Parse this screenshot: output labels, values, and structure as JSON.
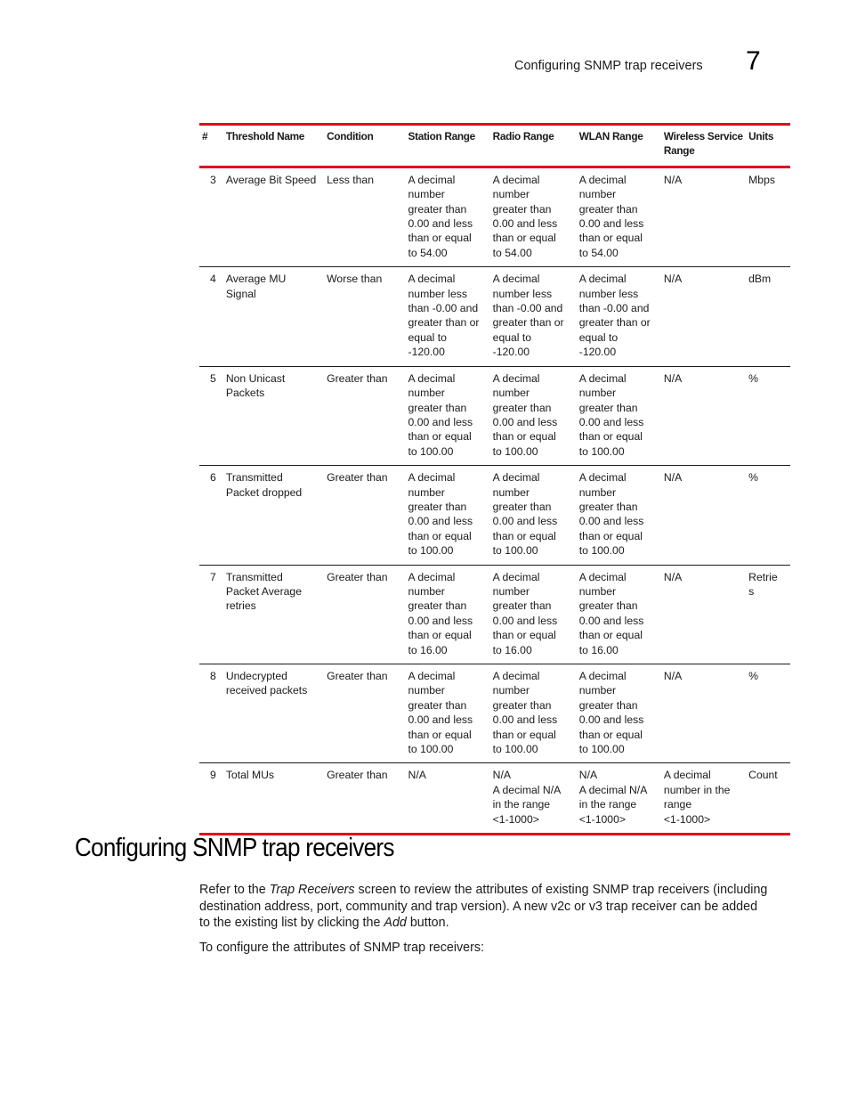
{
  "header": {
    "running_title": "Configuring SNMP trap receivers",
    "chapter_number": "7"
  },
  "table": {
    "columns": [
      "#",
      "Threshold Name",
      "Condition",
      "Station Range",
      "Radio Range",
      "WLAN Range",
      "Wireless Service Range",
      "Units"
    ],
    "rows": [
      {
        "num": "3",
        "name": "Average Bit Speed",
        "condition": "Less than",
        "station": "A decimal\nnumber\ngreater than\n0.00 and less\nthan or equal\nto 54.00",
        "radio": "A decimal\nnumber\ngreater than\n0.00 and less\nthan or equal\nto 54.00",
        "wlan": "A decimal\nnumber\ngreater than\n0.00 and less\nthan or equal\nto 54.00",
        "wsr": "N/A",
        "units": "Mbps"
      },
      {
        "num": "4",
        "name": "Average MU\nSignal",
        "condition": "Worse than",
        "station": "A decimal\nnumber less\nthan -0.00 and\ngreater than or\nequal to\n-120.00",
        "radio": "A decimal\nnumber less\nthan -0.00 and\ngreater than or\nequal to\n-120.00",
        "wlan": "A decimal\nnumber less\nthan -0.00 and\ngreater than or\nequal to\n-120.00",
        "wsr": "N/A",
        "units": "dBm"
      },
      {
        "num": "5",
        "name": "Non Unicast\nPackets",
        "condition": "Greater than",
        "station": "A decimal\nnumber\ngreater than\n0.00 and less\nthan or equal\nto 100.00",
        "radio": "A decimal\nnumber\ngreater than\n0.00 and less\nthan or equal\nto 100.00",
        "wlan": "A decimal\nnumber\ngreater than\n0.00 and less\nthan or equal\nto 100.00",
        "wsr": "N/A",
        "units": "%"
      },
      {
        "num": "6",
        "name": "Transmitted\nPacket dropped",
        "condition": "Greater than",
        "station": "A decimal\nnumber\ngreater than\n0.00 and less\nthan or equal\nto 100.00",
        "radio": "A decimal\nnumber\ngreater than\n0.00 and less\nthan or equal\nto 100.00",
        "wlan": "A decimal\nnumber\ngreater than\n0.00 and less\nthan or equal\nto 100.00",
        "wsr": "N/A",
        "units": "%"
      },
      {
        "num": "7",
        "name": "Transmitted\nPacket Average\nretries",
        "condition": "Greater than",
        "station": "A decimal\nnumber\ngreater than\n0.00 and less\nthan or equal\nto 16.00",
        "radio": "A decimal\nnumber\ngreater than\n0.00 and less\nthan or equal\nto 16.00",
        "wlan": "A decimal\nnumber\ngreater than\n0.00 and less\nthan or equal\nto 16.00",
        "wsr": "N/A",
        "units": "Retrie\ns"
      },
      {
        "num": "8",
        "name": "Undecrypted\nreceived packets",
        "condition": "Greater than",
        "station": "A decimal\nnumber\ngreater than\n0.00 and less\nthan or equal\nto 100.00",
        "radio": "A decimal\nnumber\ngreater than\n0.00 and less\nthan or equal\nto 100.00",
        "wlan": "A decimal\nnumber\ngreater than\n0.00 and less\nthan or equal\nto 100.00",
        "wsr": "N/A",
        "units": "%"
      },
      {
        "num": "9",
        "name": "Total MUs",
        "condition": "Greater than",
        "station": "N/A",
        "radio": "N/A\nA decimal N/A\nin the range\n<1-1000>",
        "wlan": "N/A\nA decimal N/A\nin the range\n<1-1000>",
        "wsr": "A decimal\nnumber in the\nrange\n<1-1000>",
        "units": "Count"
      }
    ]
  },
  "section": {
    "title": "Configuring SNMP trap receivers",
    "paragraph1": {
      "pre": "Refer to the ",
      "em1": "Trap Receivers",
      "mid": " screen to review the attributes of existing SNMP trap receivers (including destination address, port, community and trap version). A new v2c or v3 trap receiver can be added to the existing list by clicking the ",
      "em2": "Add",
      "post": " button."
    },
    "paragraph2": "To configure the attributes of SNMP trap receivers:"
  }
}
